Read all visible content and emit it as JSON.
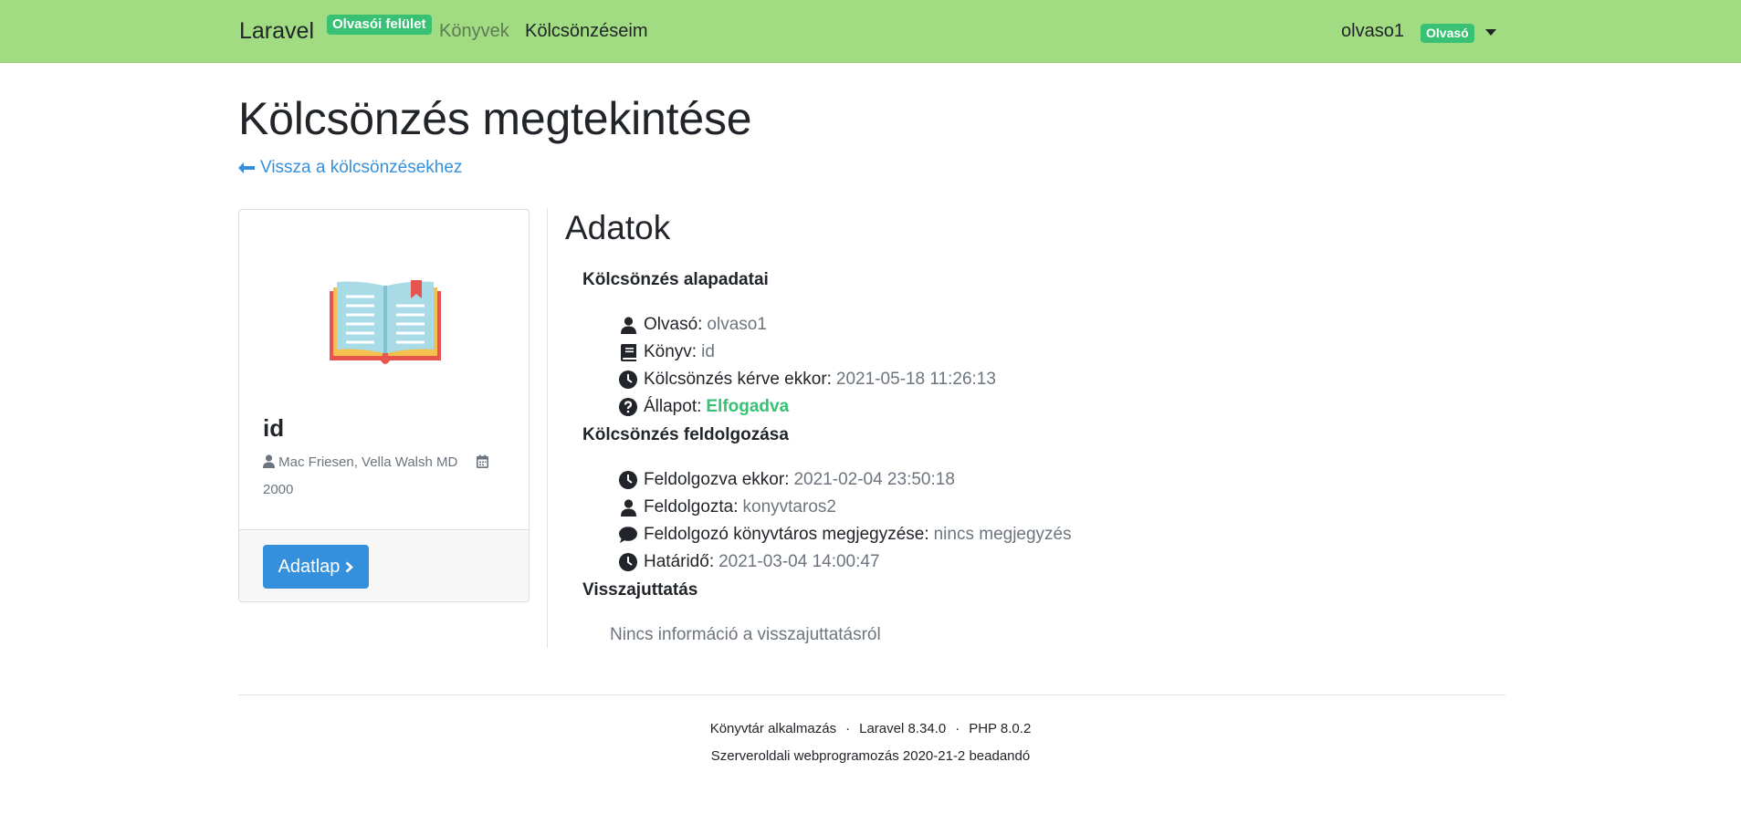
{
  "navbar": {
    "brand": "Laravel",
    "area_badge": "Olvasói felület",
    "links": [
      "Könyvek",
      "Kölcsönzéseim"
    ],
    "user": "olvaso1",
    "role_badge": "Olvasó"
  },
  "page": {
    "title": "Kölcsönzés megtekintése",
    "back_link": "Vissza a kölcsönzésekhez"
  },
  "book_card": {
    "title": "id",
    "authors": "Mac Friesen, Vella Walsh MD",
    "year": "2000",
    "button_label": "Adatlap"
  },
  "details": {
    "title": "Adatok",
    "basic_section": "Kölcsönzés alapadatai",
    "reader_label": "Olvasó:",
    "reader_value": "olvaso1",
    "book_label": "Könyv:",
    "book_value": "id",
    "requested_label": "Kölcsönzés kérve ekkor:",
    "requested_value": "2021-05-18 11:26:13",
    "status_label": "Állapot:",
    "status_value": "Elfogadva",
    "processing_section": "Kölcsönzés feldolgozása",
    "processed_at_label": "Feldolgozva ekkor:",
    "processed_at_value": "2021-02-04 23:50:18",
    "processed_by_label": "Feldolgozta:",
    "processed_by_value": "konyvtaros2",
    "note_label": "Feldolgozó könyvtáros megjegyzése:",
    "note_value": "nincs megjegyzés",
    "deadline_label": "Határidő:",
    "deadline_value": "2021-03-04 14:00:47",
    "return_section": "Visszajuttatás",
    "return_info": "Nincs információ a visszajuttatásról"
  },
  "footer": {
    "app": "Könyvtár alkalmazás",
    "laravel": "Laravel 8.34.0",
    "php": "PHP 8.0.2",
    "separator": "·",
    "course": "Szerveroldali webprogramozás 2020-21-2 beadandó"
  },
  "colors": {
    "navbar": "#a1dc82",
    "accent": "#3490dc",
    "success": "#38c172",
    "muted": "#6c757d"
  },
  "icons": [
    "arrow-left-icon",
    "open-book-icon",
    "user-icon",
    "calendar-icon",
    "chevron-right-icon",
    "book-icon",
    "clock-icon",
    "question-circle-icon",
    "comment-icon",
    "caret-down-icon"
  ]
}
